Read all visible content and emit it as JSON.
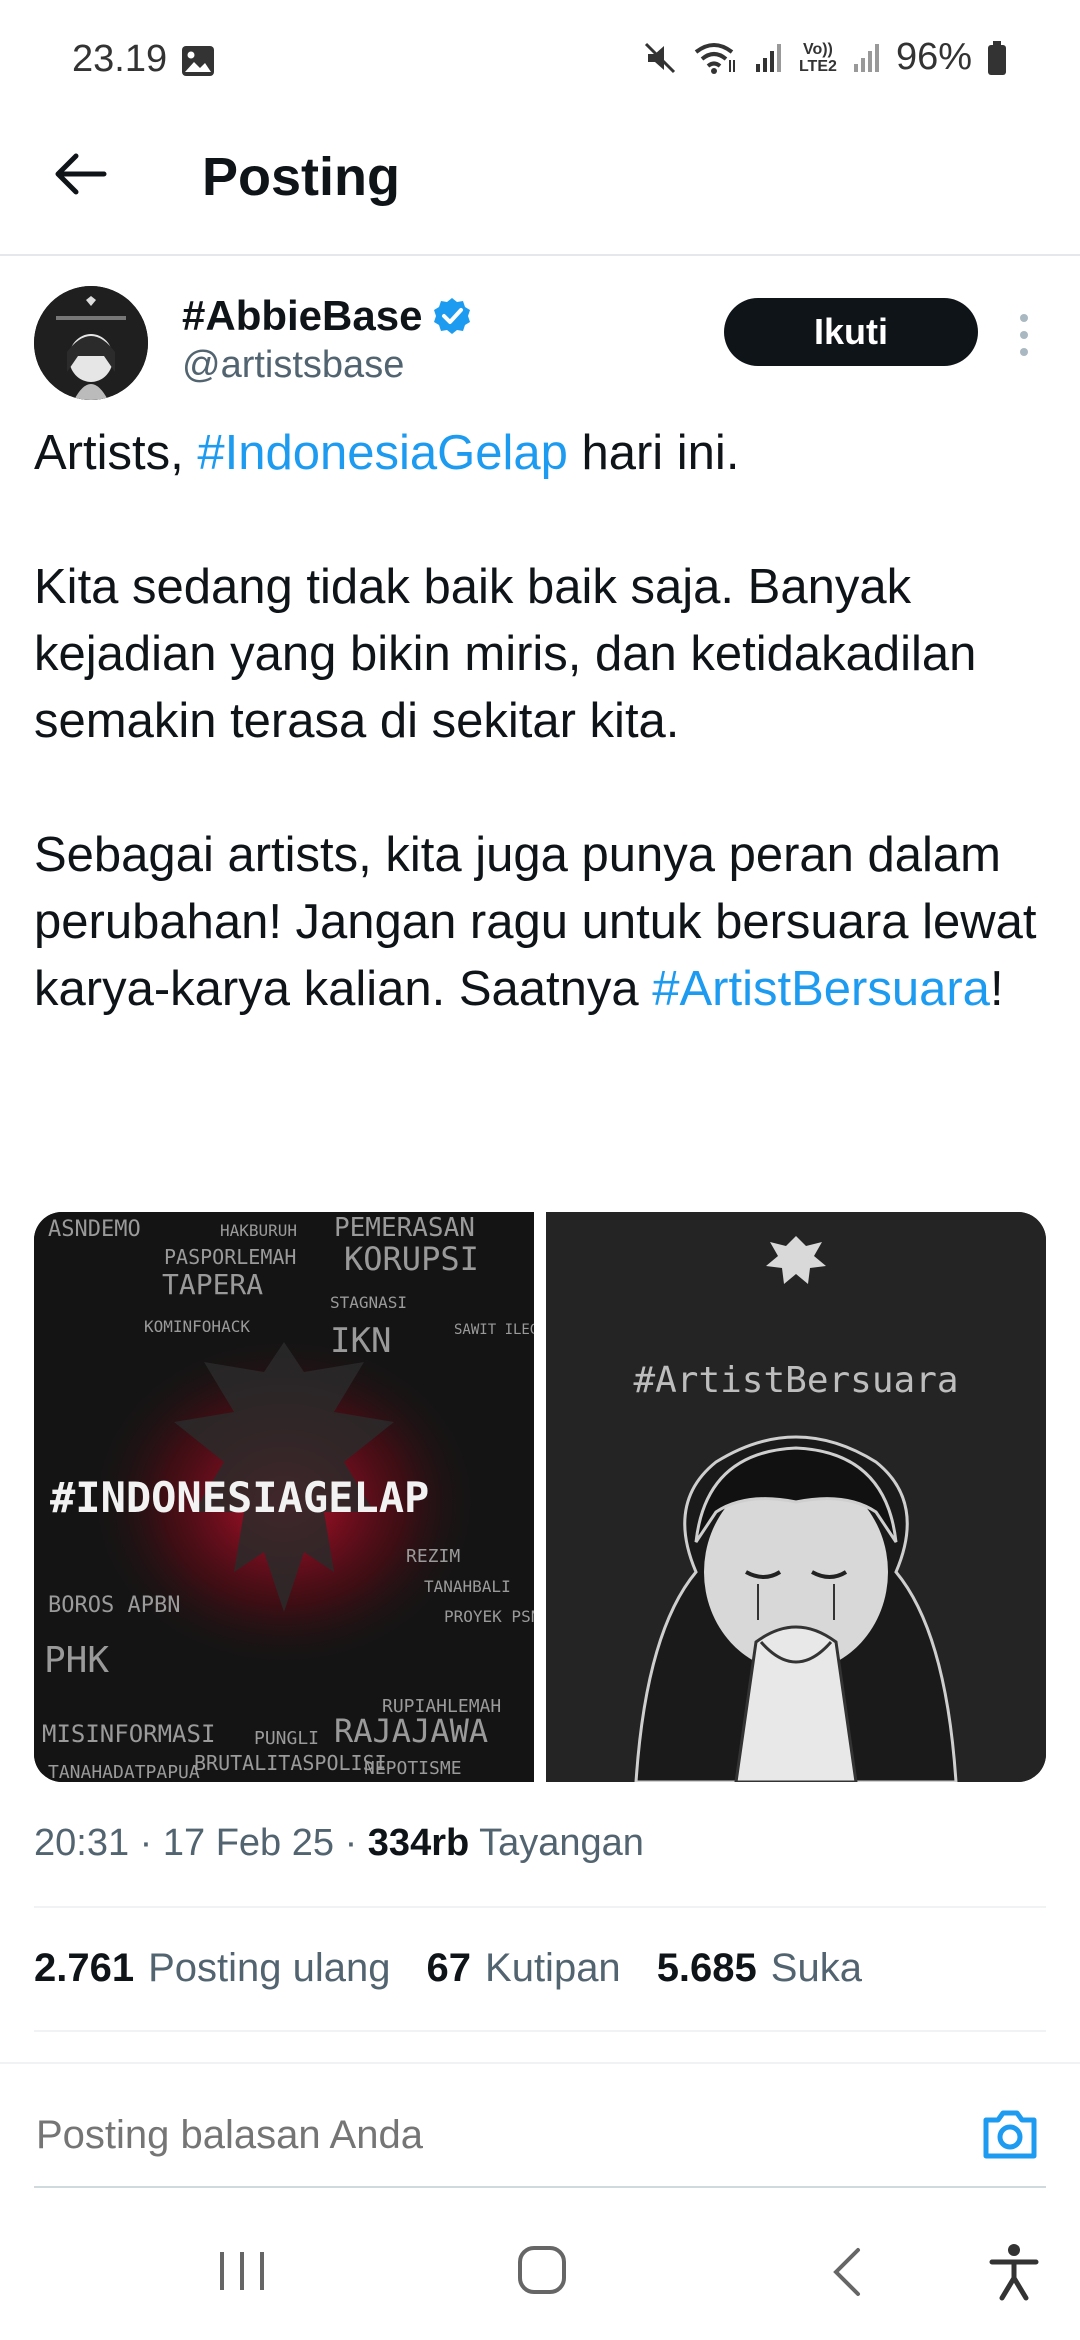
{
  "status_bar": {
    "time": "23.19",
    "battery": "96%",
    "network": "Vo)) LTE2"
  },
  "header": {
    "title": "Posting"
  },
  "author": {
    "name": "#AbbieBase",
    "handle": "@artistsbase",
    "follow_label": "Ikuti"
  },
  "tweet": {
    "p1_pre": "Artists, ",
    "p1_tag": "#IndonesiaGelap",
    "p1_post": " hari ini.",
    "p2": "Kita sedang tidak baik baik saja. Banyak kejadian yang bikin miris, dan ketidakadilan semakin terasa di sekitar kita.",
    "p3_pre": "Sebagai artists, kita juga punya peran dalam perubahan! Jangan ragu untuk bersuara lewat karya-karya kalian. Saatnya ",
    "p3_tag": "#ArtistBersuara",
    "p3_post": "!"
  },
  "images": {
    "left_headline": "#INDONESIAGELAP",
    "left_words": [
      "ASNDEMO",
      "HAKBURUH",
      "PEMERASAN",
      "PASPORLEMAH",
      "KORUPSI",
      "TAPERA",
      "STAGNASI",
      "KOMINFOHACK",
      "IKN",
      "SAWIT ILEGAL",
      "BOROS APBN",
      "PHK",
      "REZIM",
      "TANAHBALI",
      "PROYEK PSN",
      "RUPIAHLEMAH",
      "MISINFORMASI",
      "PUNGLI",
      "RAJAJAWA",
      "BRUTALITASPOLISI",
      "NEPOTISME",
      "TANAHADATPAPUA"
    ],
    "right_caption": "#ArtistBersuara"
  },
  "meta": {
    "time": "20:31",
    "date": "17 Feb 25",
    "views": "334rb",
    "views_label": "Tayangan"
  },
  "stats": {
    "reposts": "2.761",
    "reposts_label": "Posting ulang",
    "quotes": "67",
    "quotes_label": "Kutipan",
    "likes": "5.685",
    "likes_label": "Suka"
  },
  "reply": {
    "placeholder": "Posting balasan Anda"
  },
  "colors": {
    "accent": "#1d9bf0",
    "text": "#0f1419",
    "muted": "#536471"
  },
  "icons": [
    "image-icon",
    "mute-icon",
    "wifi-icon",
    "signal-icon",
    "battery-icon",
    "back-arrow-icon",
    "verified-icon",
    "more-vertical-icon",
    "camera-icon",
    "recents-icon",
    "home-icon",
    "nav-back-icon",
    "accessibility-icon"
  ]
}
